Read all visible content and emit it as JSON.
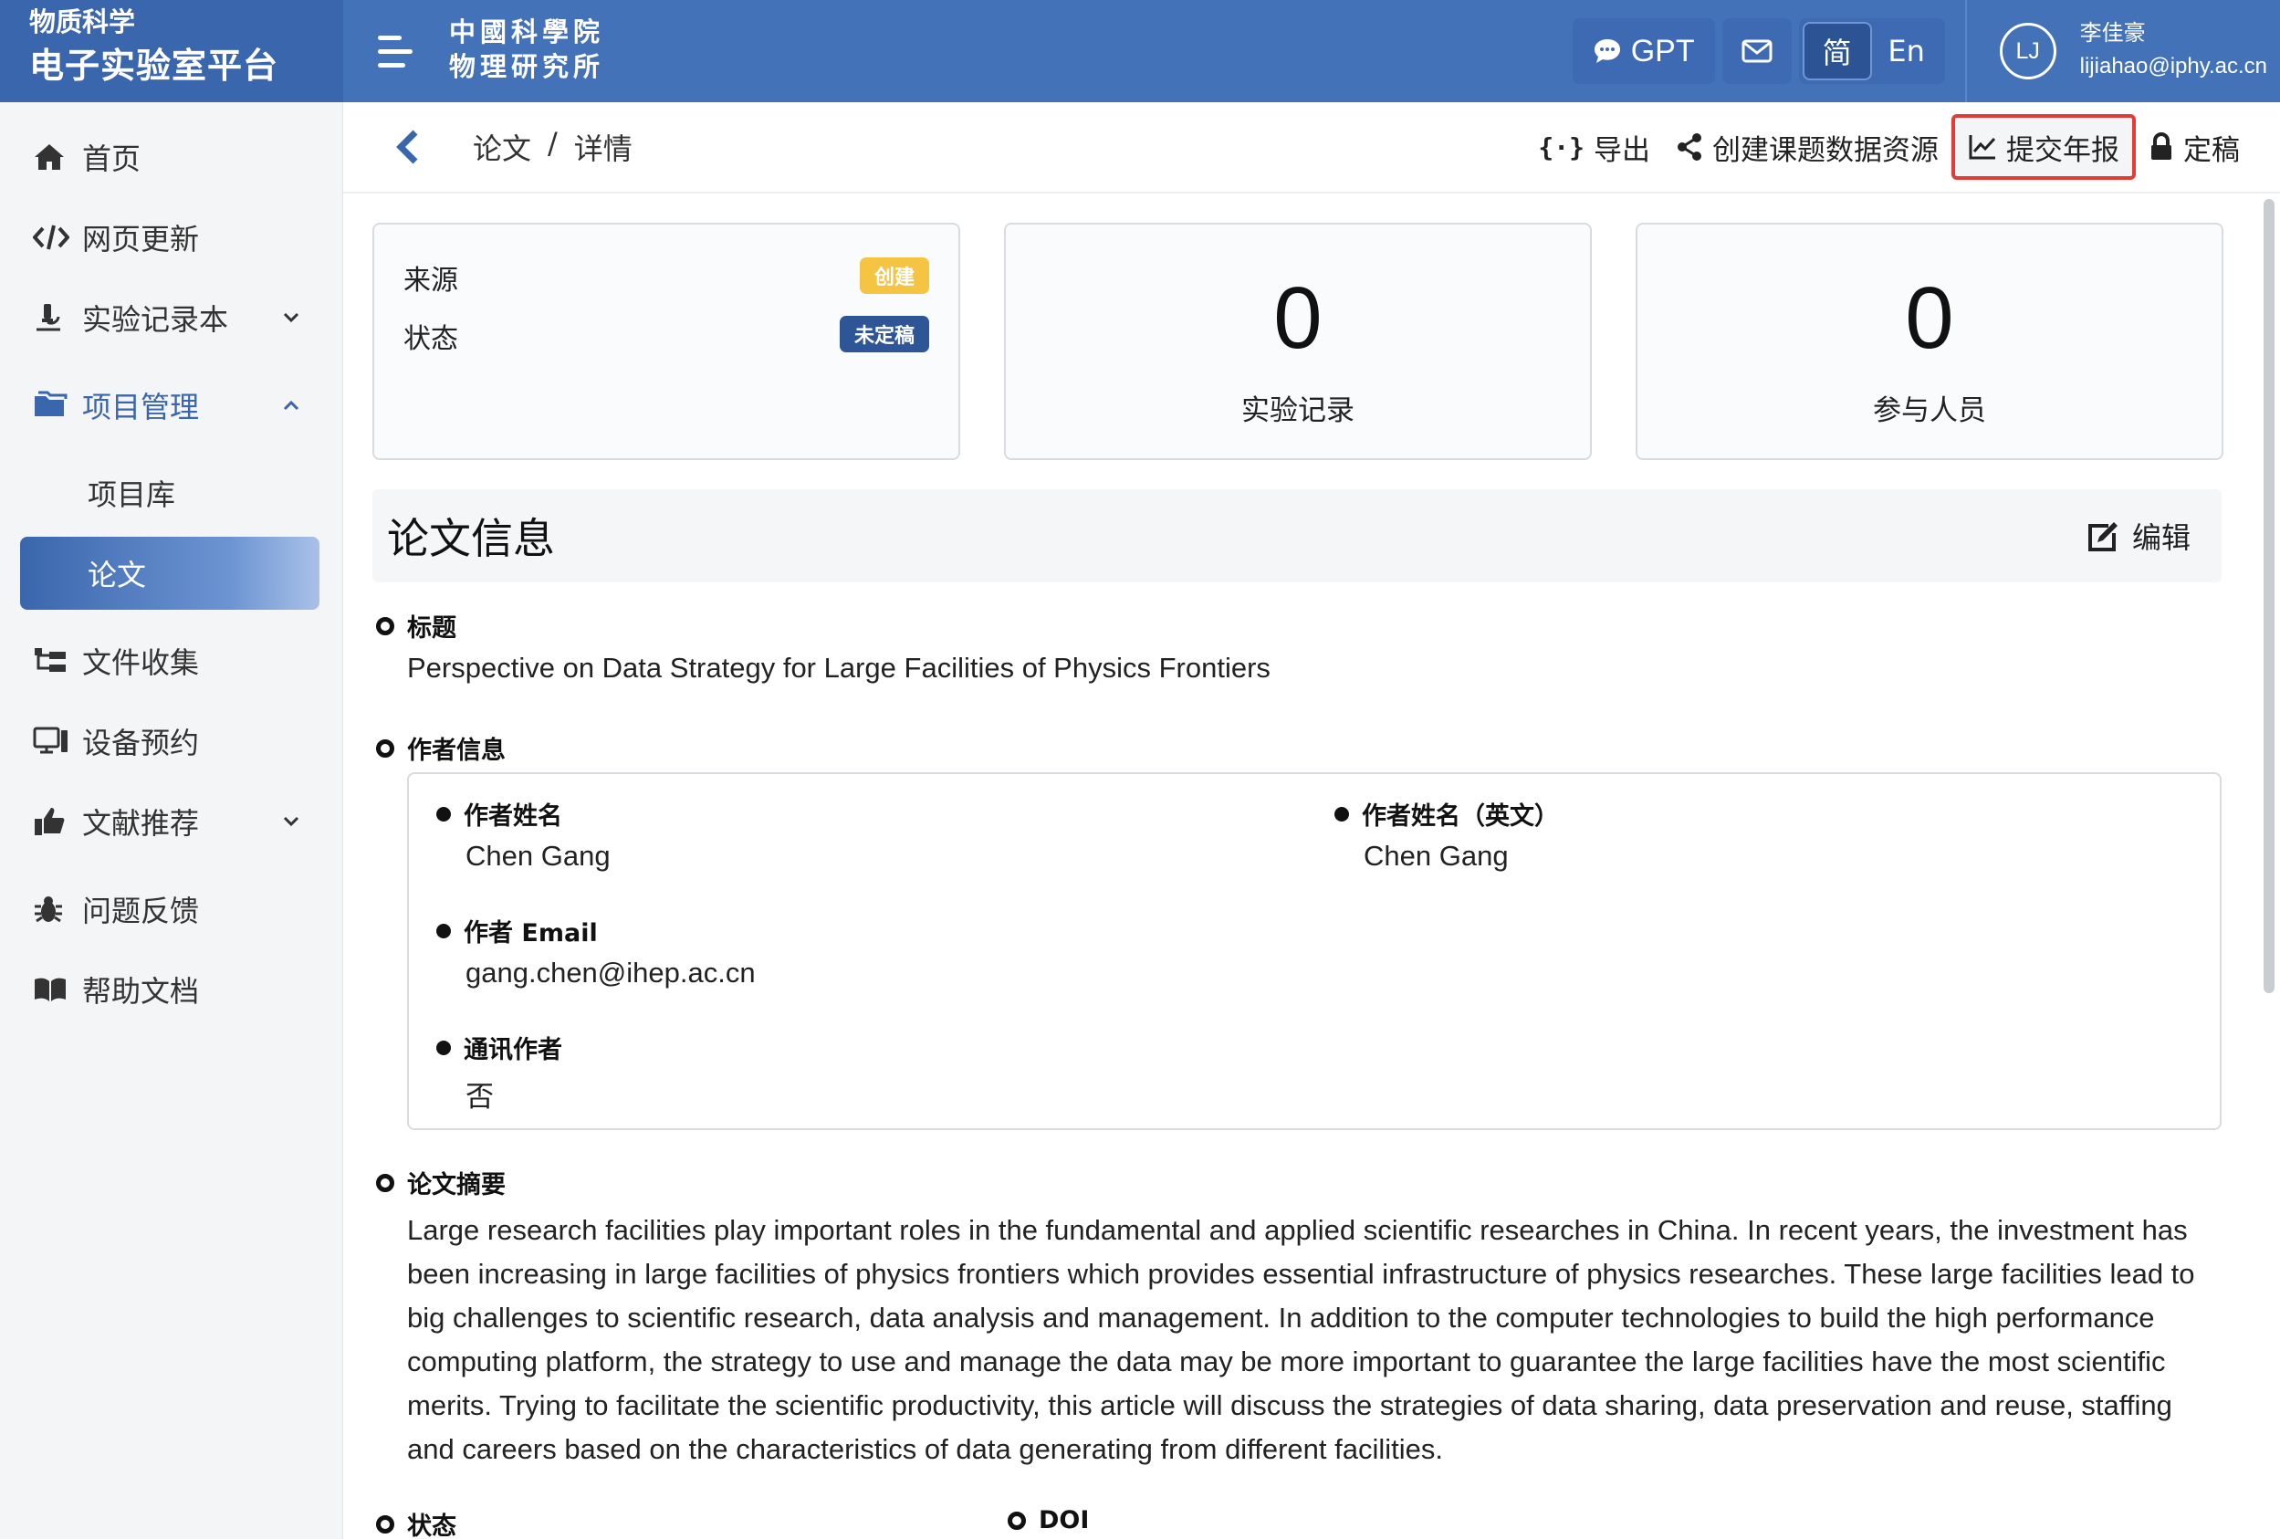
{
  "brand": {
    "subtitle": "物质科学",
    "title": "电子实验室平台"
  },
  "logo": {
    "line1": "中國科學院",
    "line2": "物理研究所"
  },
  "topbar": {
    "gpt_label": "GPT",
    "lang_zh": "简",
    "lang_en": "En"
  },
  "user": {
    "initials": "LJ",
    "name": "李佳豪",
    "email": "lijiahao@iphy.ac.cn"
  },
  "sidebar": {
    "home": "首页",
    "web_update": "网页更新",
    "lab_notebook": "实验记录本",
    "project_mgmt": "项目管理",
    "project_lib": "项目库",
    "papers": "论文",
    "file_collect": "文件收集",
    "device_booking": "设备预约",
    "lit_recommend": "文献推荐",
    "feedback": "问题反馈",
    "help_docs": "帮助文档"
  },
  "breadcrumb": {
    "parent": "论文",
    "sep": "/",
    "current": "详情"
  },
  "actions": {
    "export": "导出",
    "create_resource": "创建课题数据资源",
    "submit_report": "提交年报",
    "finalize": "定稿"
  },
  "meta_card": {
    "source_label": "来源",
    "source_badge": "创建",
    "status_label": "状态",
    "status_badge": "未定稿"
  },
  "stats": [
    {
      "value": "0",
      "label": "实验记录"
    },
    {
      "value": "0",
      "label": "参与人员"
    }
  ],
  "section": {
    "title": "论文信息",
    "edit_label": "编辑"
  },
  "paper": {
    "title_label": "标题",
    "title_value": "Perspective on Data Strategy for Large Facilities of Physics Frontiers",
    "author_section_label": "作者信息",
    "author_name_label": "作者姓名",
    "author_name_value": "Chen Gang",
    "author_name_en_label": "作者姓名（英文）",
    "author_name_en_value": "Chen Gang",
    "author_email_label": "作者 Email",
    "author_email_value": "gang.chen@ihep.ac.cn",
    "corresponding_label": "通讯作者",
    "corresponding_value": "否",
    "abstract_label": "论文摘要",
    "abstract_value": "Large research facilities play important roles in the fundamental and applied scientific researches in China. In recent years, the investment has been increasing in large facilities of physics frontiers which provides essential infrastructure of physics researches. These large facilities lead to big challenges to scientific research, data analysis and management. In addition to the computer technologies to build the high performance computing platform, the strategy to use and manage the data may be more important to guarantee the large facilities have the most scientific merits. Trying to facilitate the scientific productivity, this article will discuss the strategies of data sharing, data preservation and reuse, staffing and careers based on the characteristics of data generating from different facilities.",
    "status_label": "状态",
    "doi_label": "DOI"
  }
}
